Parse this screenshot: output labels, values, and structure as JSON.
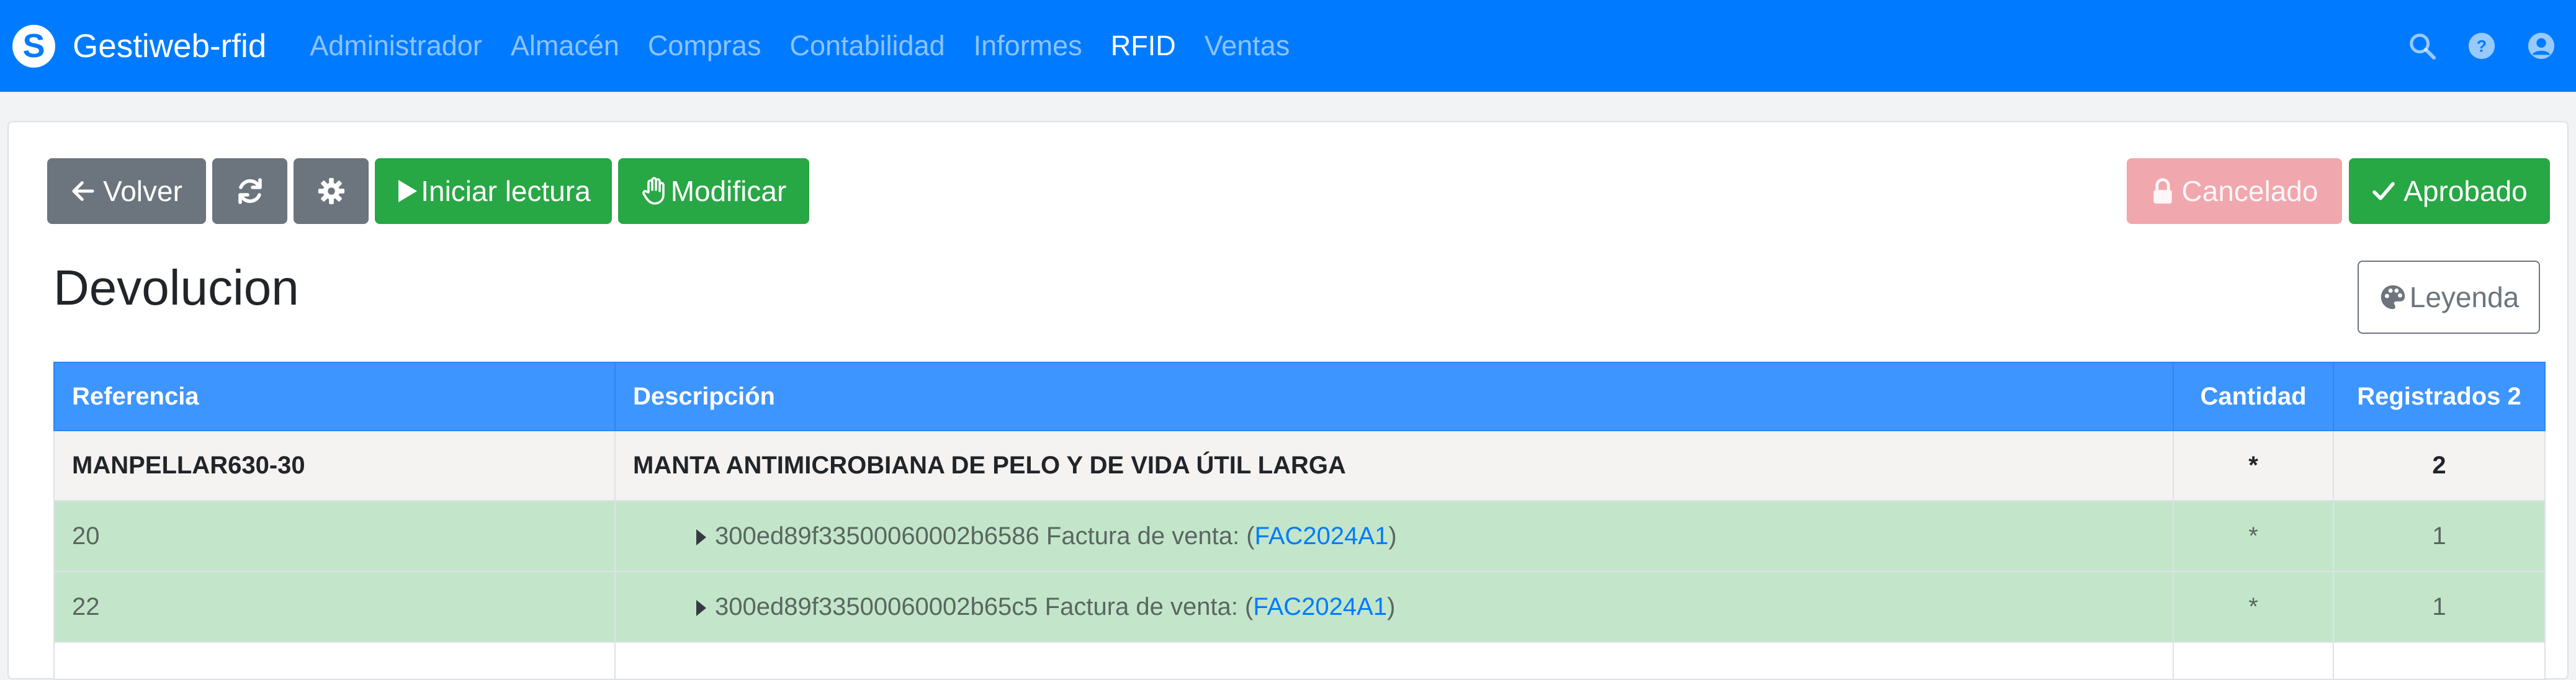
{
  "app": {
    "brand_logo_letter": "S",
    "brand_name": "Gestiweb-rfid",
    "menu": [
      {
        "label": "Administrador"
      },
      {
        "label": "Almacén"
      },
      {
        "label": "Compras"
      },
      {
        "label": "Contabilidad"
      },
      {
        "label": "Informes"
      },
      {
        "label": "RFID"
      },
      {
        "label": "Ventas"
      }
    ],
    "active_menu": "RFID",
    "right_icons": [
      "search-icon",
      "help-icon",
      "user-icon"
    ]
  },
  "toolbar": {
    "back_label": "Volver",
    "start_read_label": "Iniciar lectura",
    "modify_label": "Modificar",
    "cancel_label": "Cancelado",
    "approve_label": "Aprobado",
    "legend_label": "Leyenda",
    "icons": {
      "back": "arrow-left-icon",
      "refresh": "refresh-icon",
      "settings": "gear-icon",
      "start": "play-icon",
      "modify": "hand-icon",
      "cancel": "lock-icon",
      "approve": "check-icon",
      "legend": "palette-icon"
    }
  },
  "page": {
    "title": "Devolucion"
  },
  "table": {
    "headers": {
      "referencia": "Referencia",
      "descripcion": "Descripción",
      "cantidad": "Cantidad",
      "registrados": "Registrados 2"
    },
    "main_row": {
      "referencia": "MANPELLAR630-30",
      "descripcion": "MANTA ANTIMICROBIANA DE PELO Y DE VIDA ÚTIL LARGA",
      "cantidad": "*",
      "registrados": "2"
    },
    "sub_rows": [
      {
        "referencia": "20",
        "tag": "300ed89f33500060002b6586",
        "doc_prefix": "Factura de venta: (",
        "doc_link": "FAC2024A1",
        "doc_suffix": ")",
        "cantidad": "*",
        "registrados": "1"
      },
      {
        "referencia": "22",
        "tag": "300ed89f33500060002b65c5",
        "doc_prefix": "Factura de venta: (",
        "doc_link": "FAC2024A1",
        "doc_suffix": ")",
        "cantidad": "*",
        "registrados": "1"
      }
    ]
  },
  "colors": {
    "navbar": "#007bff",
    "table_header": "#3d95ff",
    "success": "#28a745",
    "secondary": "#6c757d",
    "danger_disabled": "#f1a7ae",
    "row_green": "#c3e6cb",
    "row_main": "#f4f3f2",
    "link": "#007bff"
  }
}
